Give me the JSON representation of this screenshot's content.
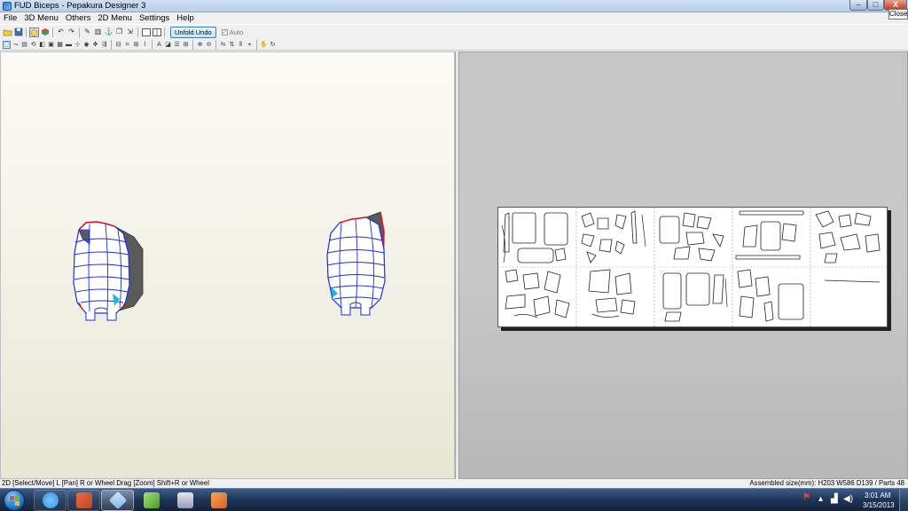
{
  "window": {
    "title": "FUD Biceps - Pepakura Designer 3",
    "close_tooltip": "Close",
    "min_glyph": "–",
    "max_glyph": "□",
    "close_glyph": "X"
  },
  "menu": [
    {
      "label": "File"
    },
    {
      "label": "3D Menu"
    },
    {
      "label": "Others"
    },
    {
      "label": "2D Menu"
    },
    {
      "label": "Settings"
    },
    {
      "label": "Help"
    }
  ],
  "toolbar": {
    "unfold_undo_label": "Unfold Undo",
    "auto_label": "Auto",
    "auto_checked": true,
    "auto_check_glyph": "✓"
  },
  "status": {
    "left": "2D [Select/Move] L [Pan] R or Wheel Drag [Zoom] Shift+R or Wheel",
    "right": "Assembled size(mm): H203 W586 D139 / Parts 48"
  },
  "taskbar": {
    "apps": [
      {
        "name": "internet-explorer",
        "color": "#2f8fe0"
      },
      {
        "name": "3d-app",
        "color": "#c0452a"
      },
      {
        "name": "pepakura-designer",
        "color": "#7fb5e6"
      },
      {
        "name": "notepad-plus-plus",
        "color": "#6cbf3a"
      },
      {
        "name": "game-app",
        "color": "#b8b8d0"
      },
      {
        "name": "office-app",
        "color": "#e07a2a"
      }
    ],
    "clock_time": "3:01 AM",
    "clock_date": "3/15/2013"
  },
  "colors": {
    "mesh_blue": "#1c2ee0",
    "edge_red": "#e0101a",
    "edge_cyan": "#19b7e6",
    "dark_face": "#5a5a5a"
  }
}
